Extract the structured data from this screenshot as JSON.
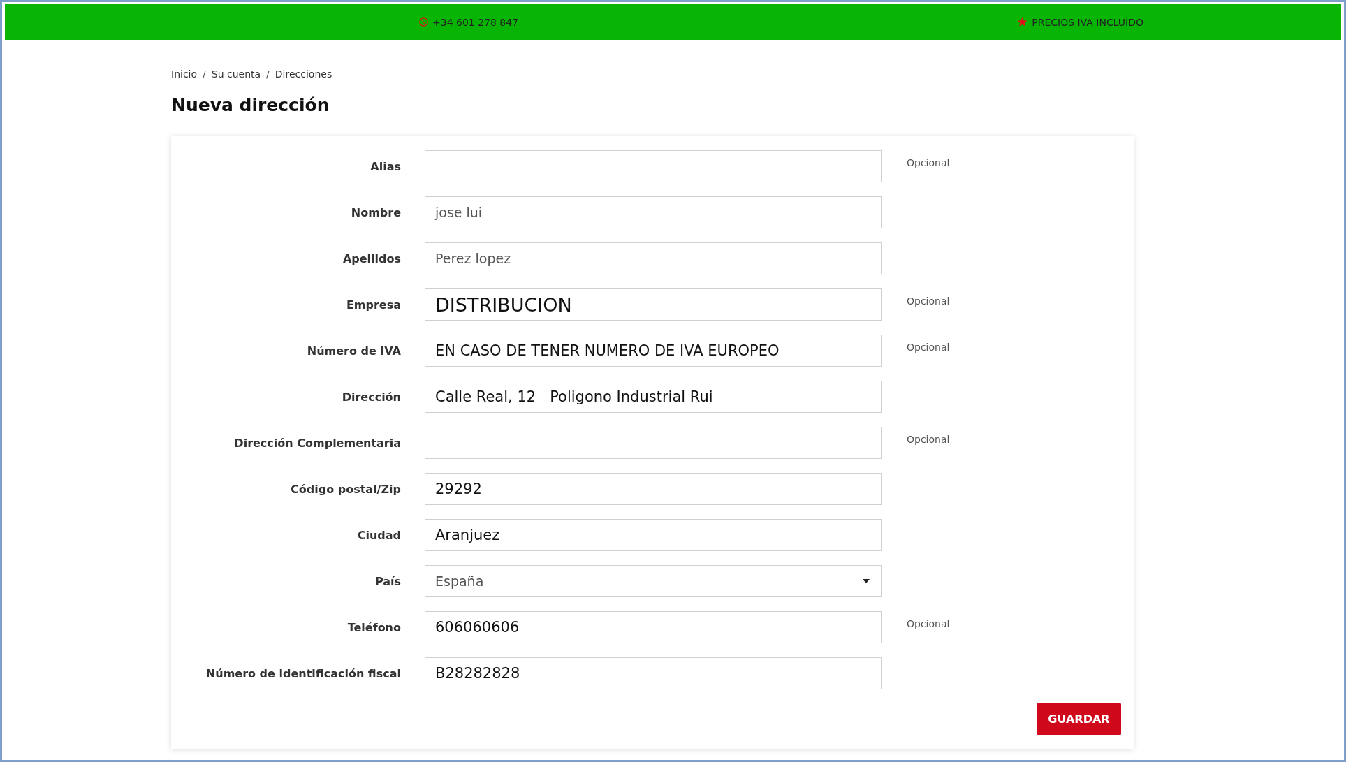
{
  "top_bar": {
    "phone": "+34 601 278 847",
    "notice": "PRECIOS IVA INCLUÍDO"
  },
  "breadcrumb": [
    {
      "kind": "link",
      "text": "Inicio"
    },
    {
      "kind": "separator",
      "text": "/"
    },
    {
      "kind": "link",
      "text": "Su cuenta"
    },
    {
      "kind": "separator",
      "text": "/"
    },
    {
      "kind": "link",
      "text": "Direcciones"
    }
  ],
  "title": "Nueva dirección",
  "form": {
    "fields": [
      {
        "label": "Alias",
        "kind": "text",
        "optional": "Opcional"
      },
      {
        "label": "Nombre",
        "kind": "text",
        "value": "jose lui",
        "muted": true
      },
      {
        "label": "Apellidos",
        "kind": "text",
        "value": "Perez lopez",
        "muted": true
      },
      {
        "label": "Empresa",
        "kind": "text",
        "value": "DISTRIBUCION",
        "muted": false,
        "large": true,
        "optional": "Opcional"
      },
      {
        "label": "Número de IVA",
        "kind": "text",
        "value": "EN CASO DE TENER NUMERO DE IVA EUROPEO",
        "muted": false,
        "optional": "Opcional"
      },
      {
        "label": "Dirección",
        "kind": "text",
        "value": "Calle Real, 12   Poligono Industrial Rui",
        "muted": false
      },
      {
        "label": "Dirección Complementaria",
        "kind": "text",
        "optional": "Opcional"
      },
      {
        "label": "Código postal/Zip",
        "kind": "text",
        "value": "29292",
        "muted": false
      },
      {
        "label": "Ciudad",
        "kind": "text",
        "value": "Aranjuez",
        "muted": false
      },
      {
        "label": "País",
        "kind": "select",
        "value": "España",
        "muted": true
      },
      {
        "label": "Teléfono",
        "kind": "text",
        "value": "606060606",
        "muted": false,
        "optional": "Opcional"
      },
      {
        "label": "Número de identificación fiscal",
        "kind": "text",
        "value": "B28282828",
        "muted": false
      }
    ],
    "submit": "GUARDAR"
  }
}
